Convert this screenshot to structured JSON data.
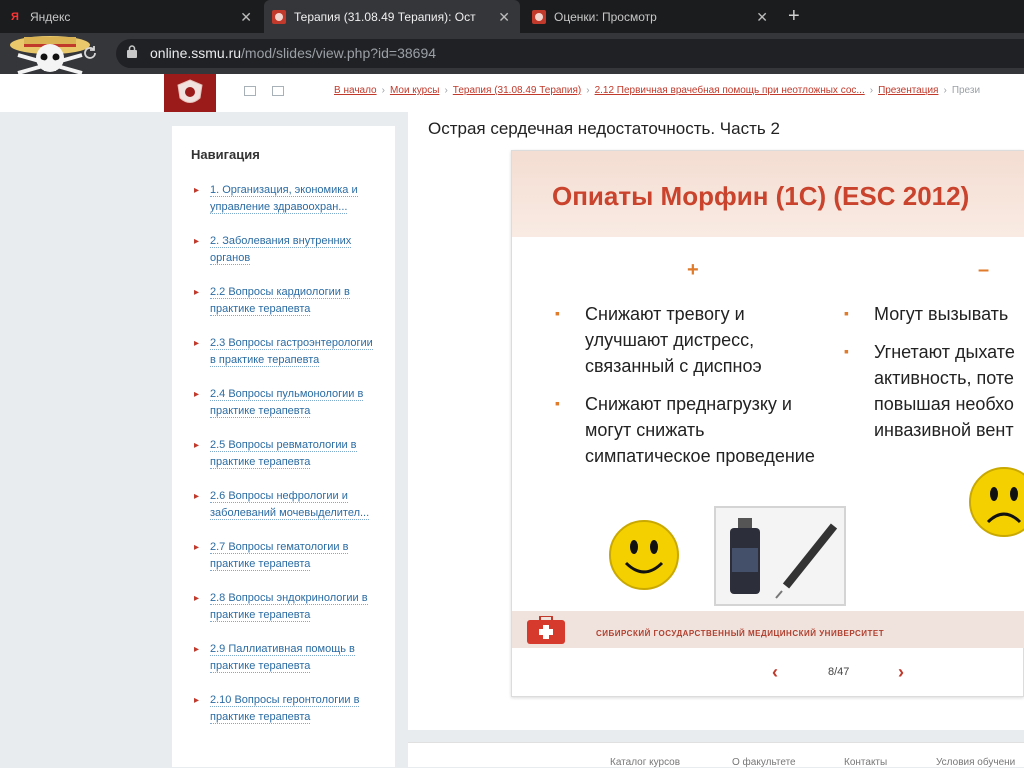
{
  "browser": {
    "tabs": [
      {
        "label": "Яндекс",
        "favicon": "Я",
        "active": false
      },
      {
        "label": "Терапия (31.08.49 Терапия): Ост",
        "favicon": "crest",
        "active": true
      },
      {
        "label": "Оценки: Просмотр",
        "favicon": "crest",
        "active": false
      }
    ],
    "new_tab": "+",
    "close_glyph": "✕",
    "url_host": "online.ssmu.ru",
    "url_path": "/mod/slides/view.php?id=38694"
  },
  "site": {
    "breadcrumbs": [
      "В начало",
      "Мои курсы",
      "Терапия (31.08.49 Терапия)",
      "2.12 Первичная врачебная помощь при неотложных сос...",
      "Презентация",
      "Прези"
    ],
    "breadcrumb_sep": "›"
  },
  "nav": {
    "title": "Навигация",
    "items": [
      "1. Организация, экономика и управление здравоохран...",
      "2. Заболевания внутренних органов",
      "2.2 Вопросы кардиологии в практике терапевта",
      "2.3 Вопросы гастроэнтерологии в практике терапевта",
      "2.4 Вопросы пульмонологии в практике терапевта",
      "2.5 Вопросы ревматологии в практике терапевта",
      "2.6 Вопросы нефрологии и заболеваний мочевыделител...",
      "2.7 Вопросы гематологии в практике терапевта",
      "2.8 Вопросы эндокринологии в практике терапевта",
      "2.9 Паллиативная помощь в практике терапевта",
      "2.10 Вопросы геронтологии в практике терапевта"
    ]
  },
  "main": {
    "page_title": "Острая сердечная недостаточность. Часть 2",
    "slide": {
      "title": "Опиаты Морфин (1С) (ESC 2012)",
      "plus": "+",
      "minus": "–",
      "pros": [
        "Снижают тревогу и улучшают дистресс, связанный с диспноэ",
        "Снижают преднагрузку и могут снижать симпатическое проведение"
      ],
      "cons": [
        "Могут вызывать",
        "Угнетают дыхате активность, поте повышая необхо инвазивной вент"
      ],
      "cons_lines": [
        [
          "Угнетают дыхате",
          "активность, поте",
          "повышая необхо",
          "инвазивной вент"
        ]
      ],
      "footer_text": "Сибирский государственный медицинский университет"
    },
    "pager": {
      "prev": "‹",
      "next": "›",
      "count": "8/47"
    }
  },
  "footer": {
    "links": [
      "Каталог курсов",
      "О факультете",
      "Контакты",
      "Условия обучени"
    ]
  },
  "colors": {
    "accent": "#c0392b",
    "slide_title": "#c9432d",
    "bullet": "#e07b2c",
    "link": "#2b6ca3"
  }
}
